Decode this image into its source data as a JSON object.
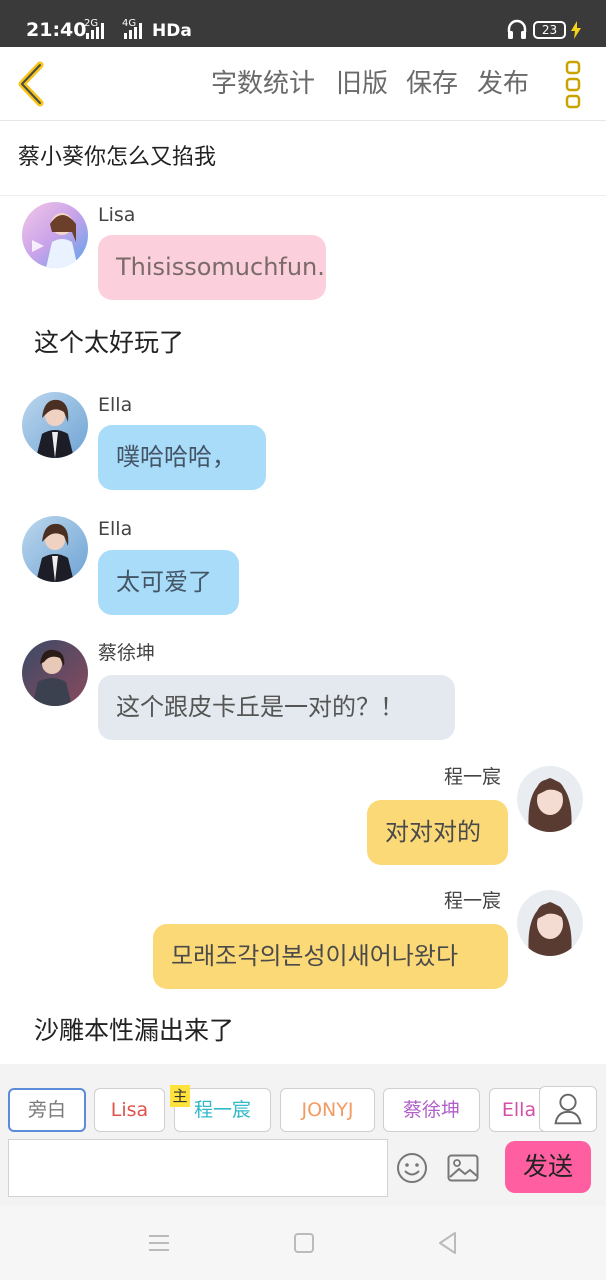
{
  "status_bar": {
    "time": "21:40",
    "network_1": "2G",
    "network_2": "4G",
    "hd": "HDa",
    "battery": "23"
  },
  "appbar": {
    "back_icon": "chevron-left-icon",
    "menu": [
      "字数统计",
      "旧版",
      "保存",
      "发布"
    ],
    "more_icon": "vertical-dots-icon",
    "accent": "#f5c518"
  },
  "title": "蔡小葵你怎么又掐我",
  "messages": [
    {
      "type": "left",
      "sender": "Lisa",
      "text": "Thisissomuchfun.",
      "bubble_color": "#fccfdc",
      "text_color": "#7a6a6a"
    },
    {
      "type": "narration",
      "text": "这个太好玩了"
    },
    {
      "type": "left",
      "sender": "Ella",
      "text": "噗哈哈哈，",
      "bubble_color": "#a8dcf9",
      "text_color": "#445566"
    },
    {
      "type": "left",
      "sender": "Ella",
      "text": "太可爱了",
      "bubble_color": "#a8dcf9",
      "text_color": "#445566"
    },
    {
      "type": "left",
      "sender": "蔡徐坤",
      "text": "这个跟皮卡丘是一对的？！",
      "bubble_color": "#e3e9ef",
      "text_color": "#555555"
    },
    {
      "type": "right",
      "sender": "程一宸",
      "text": "对对对的",
      "bubble_color": "#fcd977",
      "text_color": "#4a4a4a"
    },
    {
      "type": "right",
      "sender": "程一宸",
      "text": "모래조각의본성이새어나왔다",
      "bubble_color": "#fcd977",
      "text_color": "#4a4a4a"
    },
    {
      "type": "narration",
      "text": "沙雕本性漏出来了"
    }
  ],
  "composer": {
    "roles": [
      {
        "label": "旁白",
        "color": "#7a7a7a",
        "active": true
      },
      {
        "label": "Lisa",
        "color": "#e0524b"
      },
      {
        "label": "程一宸",
        "color": "#31b8c9",
        "host": true
      },
      {
        "label": "JONYJ",
        "color": "#f29b62"
      },
      {
        "label": "蔡徐坤",
        "color": "#b260c9"
      },
      {
        "label": "Ella",
        "color": "#d44fa8"
      }
    ],
    "host_badge": "主",
    "person_icon": "person-icon",
    "input_value": "",
    "input_placeholder": "",
    "emoji_icon": "smiley-icon",
    "image_icon": "image-icon",
    "send_label": "发送",
    "send_color": "#ff5fa0"
  },
  "navbar": {
    "icons": [
      "menu-icon",
      "home-square-icon",
      "back-triangle-icon"
    ]
  }
}
